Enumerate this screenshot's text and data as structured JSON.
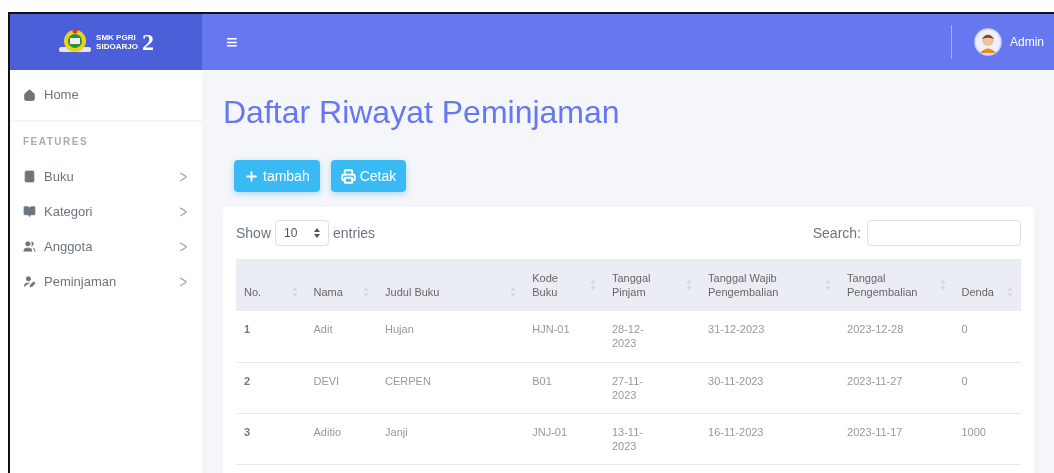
{
  "brand": {
    "logo_text": [
      "SMK PGRI",
      "SIDOARJO"
    ],
    "logo_number": "2"
  },
  "header": {
    "menu_glyph": "≡",
    "user": "Admin"
  },
  "sidebar": {
    "home": "Home",
    "section": "FEATURES",
    "items": [
      {
        "label": "Buku",
        "glyph": ">"
      },
      {
        "label": "Kategori",
        "glyph": ">"
      },
      {
        "label": "Anggota",
        "glyph": ">"
      },
      {
        "label": "Peminjaman",
        "glyph": ">"
      }
    ]
  },
  "page_title": "Daftar Riwayat Peminjaman",
  "buttons": [
    {
      "label": "tambah"
    },
    {
      "label": "Cetak"
    }
  ],
  "table": {
    "show_label": "Show",
    "entries_value": "10",
    "entries_label": "entries",
    "search_label": "Search:",
    "columns": [
      "No.",
      "Nama",
      "Judul Buku",
      "Kode Buku",
      "Tanggal Pinjam",
      "Tanggal Wajib Pengembalian",
      "Tanggal Pengembalian",
      "Denda"
    ],
    "rows": [
      [
        "1",
        "Adit",
        "Hujan",
        "HJN-01",
        "28-12-2023",
        "31-12-2023",
        "2023-12-28",
        "0"
      ],
      [
        "2",
        "DEVI",
        "CERPEN",
        "B01",
        "27-11-2023",
        "30-11-2023",
        "2023-11-27",
        "0"
      ],
      [
        "3",
        "Aditio",
        "Janji",
        "JNJ-01",
        "13-11-2023",
        "16-11-2023",
        "2023-11-17",
        "1000"
      ]
    ]
  }
}
